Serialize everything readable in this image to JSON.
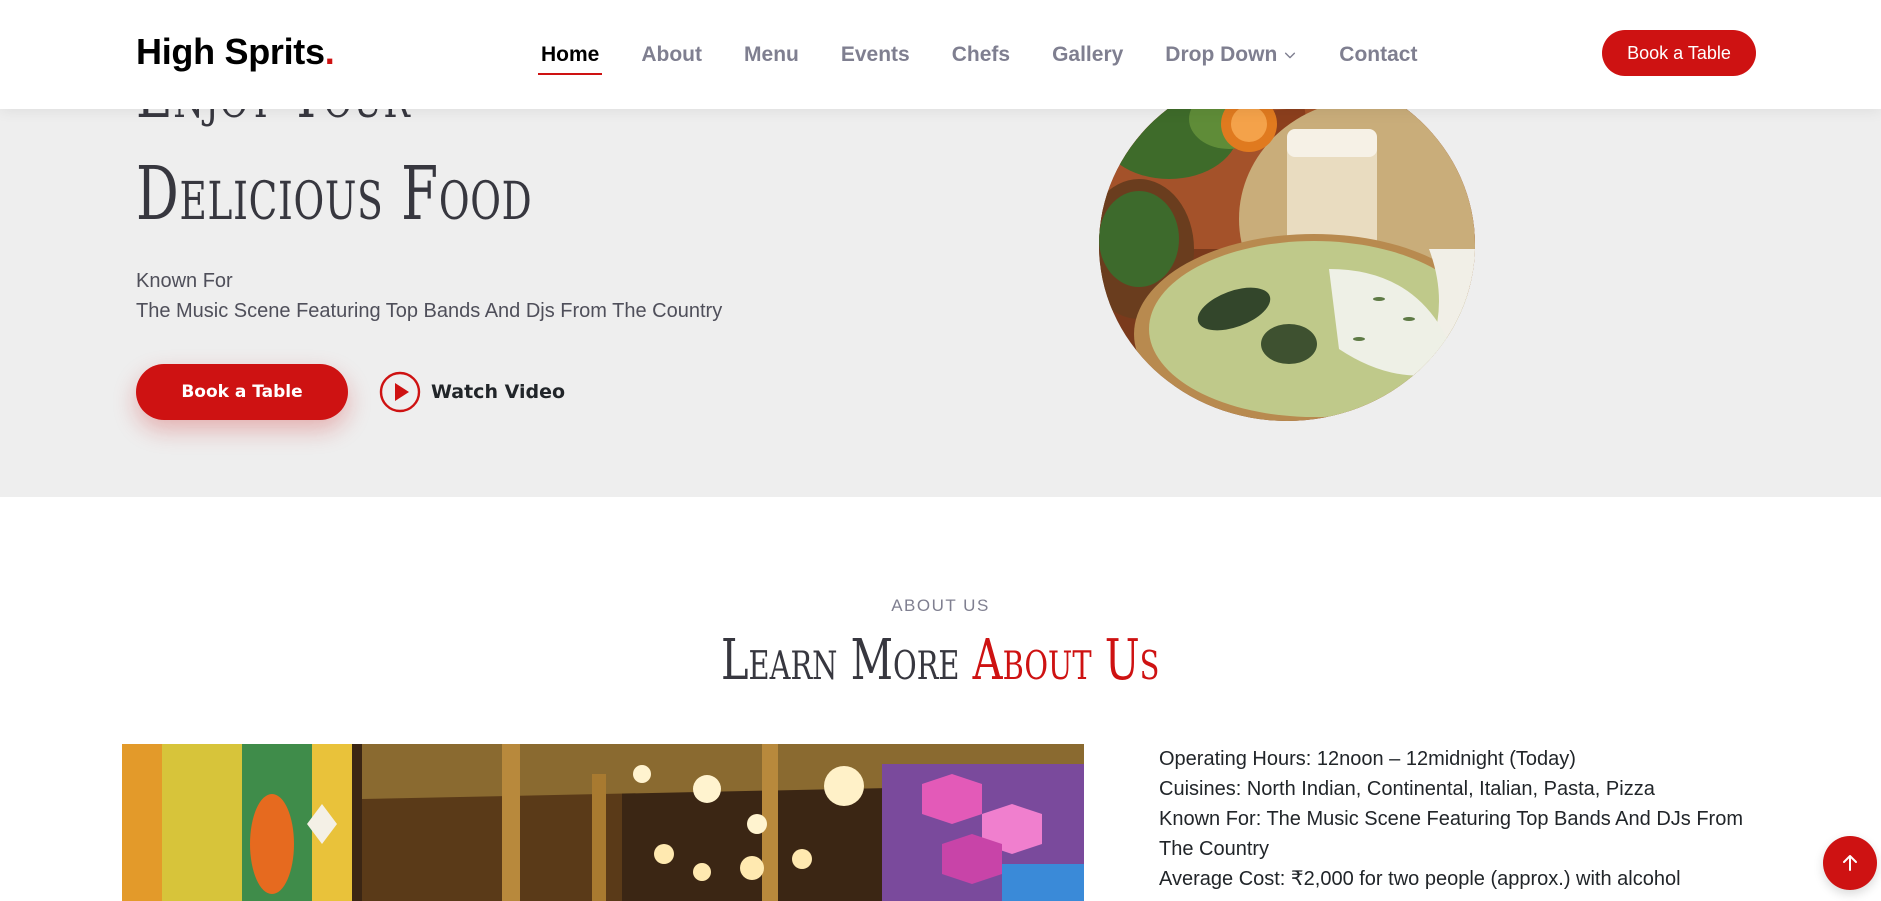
{
  "header": {
    "logo_text": "High Sprits",
    "logo_dot": ".",
    "nav": [
      "Home",
      "About",
      "Menu",
      "Events",
      "Chefs",
      "Gallery",
      "Drop Down",
      "Contact"
    ],
    "active_nav": "Home",
    "book_label": "Book a Table"
  },
  "hero": {
    "title_line1": "Enjoy Your",
    "title_line2": "Delicious Food",
    "subtitle_line1": "Known For",
    "subtitle_line2": "The Music Scene Featuring Top Bands And Djs From The Country",
    "book_label": "Book a Table",
    "watch_label": "Watch Video"
  },
  "about": {
    "kicker": "ABOUT US",
    "title_plain": "Learn More",
    "title_accent": "About Us",
    "info": [
      "Operating Hours: 12noon – 12midnight (Today)",
      "Cuisines: North Indian, Continental, Italian, Pasta, Pizza",
      "Known For: The Music Scene Featuring Top Bands And DJs From The Country",
      "Average Cost: ₹2,000 for two people (approx.) with alcohol"
    ]
  },
  "icons": {
    "dropdown": "chevron-down-icon",
    "play": "play-circle-icon",
    "scroll_top": "arrow-up-icon"
  },
  "colors": {
    "accent": "#ce1212",
    "hero_bg": "#eeeeee",
    "heading": "#37373f",
    "nav_inactive": "#7f7f90"
  }
}
